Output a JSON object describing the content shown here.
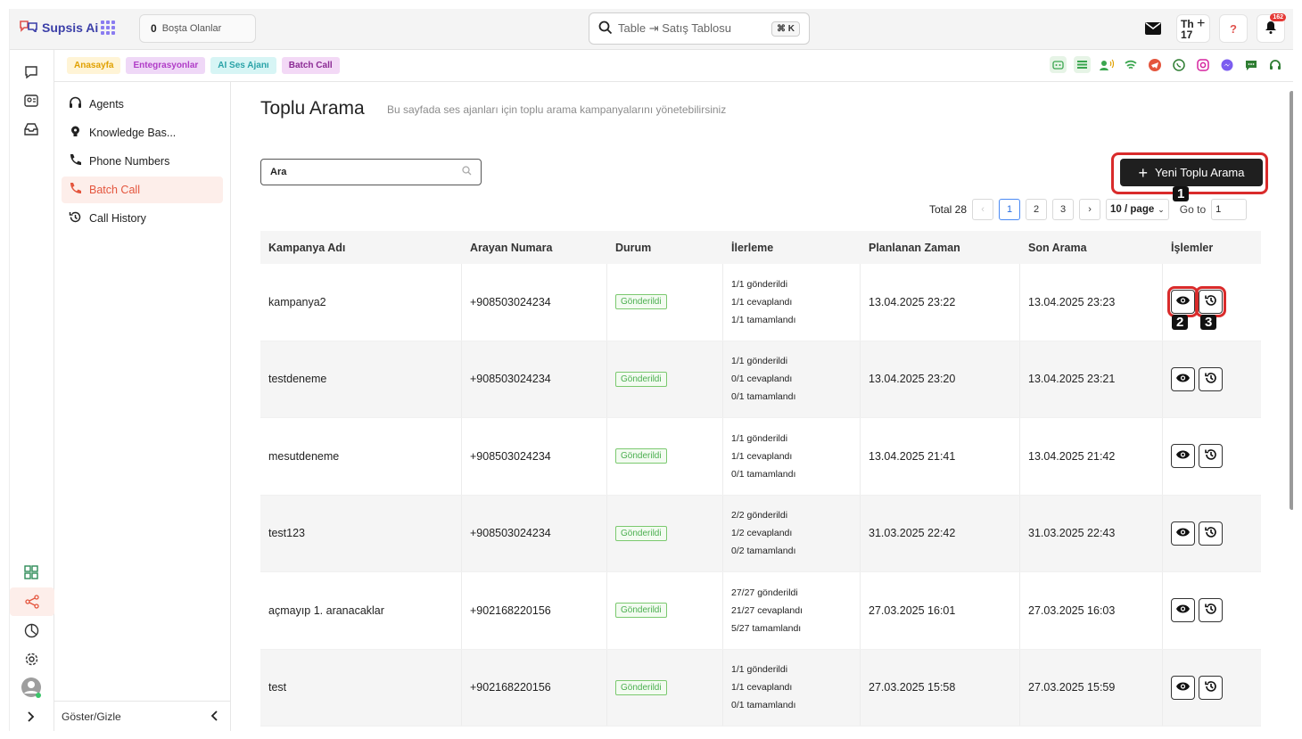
{
  "app": {
    "name": "Supsis Ai",
    "idle": {
      "count": "0",
      "label": "Boşta Olanlar"
    },
    "search": {
      "text": "Table ⇥ Satış Tablosu",
      "shortcut": "⌘ K"
    },
    "user_badge": {
      "line1": "Th",
      "line2": "17"
    },
    "help": "?",
    "notifications": "162"
  },
  "tags": [
    "Anasayfa",
    "Entegrasyonlar",
    "AI Ses Ajanı",
    "Batch Call"
  ],
  "sidenav": {
    "items": [
      {
        "label": "Agents",
        "icon": "headset-icon"
      },
      {
        "label": "Knowledge Bas...",
        "icon": "bulb-icon"
      },
      {
        "label": "Phone Numbers",
        "icon": "phone-icon"
      },
      {
        "label": "Batch Call",
        "icon": "phone-call-icon",
        "active": true
      },
      {
        "label": "Call History",
        "icon": "history-icon"
      }
    ],
    "toggle_label": "Göster/Gizle"
  },
  "page": {
    "title": "Toplu Arama",
    "subtitle": "Bu sayfada ses ajanları için toplu arama kampanyalarını yönetebilirsiniz",
    "search_placeholder": "Ara",
    "new_button": "Yeni Toplu Arama"
  },
  "pagination": {
    "total": "Total 28",
    "pages": [
      "1",
      "2",
      "3"
    ],
    "current": "1",
    "page_size": "10 / page",
    "goto_label": "Go to",
    "goto_value": "1"
  },
  "markers": [
    "1",
    "2",
    "3"
  ],
  "table": {
    "columns": [
      "Kampanya Adı",
      "Arayan Numara",
      "Durum",
      "İlerleme",
      "Planlanan Zaman",
      "Son Arama",
      "İşlemler"
    ],
    "rows": [
      {
        "name": "kampanya2",
        "number": "+908503024234",
        "status": "Gönderildi",
        "sent": "1/1 gönderildi",
        "answered": "1/1 cevaplandı",
        "completed": "1/1 tamamlandı",
        "planned": "13.04.2025 23:22",
        "last": "13.04.2025 23:23"
      },
      {
        "name": "testdeneme",
        "number": "+908503024234",
        "status": "Gönderildi",
        "sent": "1/1 gönderildi",
        "answered": "0/1 cevaplandı",
        "completed": "0/1 tamamlandı",
        "planned": "13.04.2025 23:20",
        "last": "13.04.2025 23:21"
      },
      {
        "name": "mesutdeneme",
        "number": "+908503024234",
        "status": "Gönderildi",
        "sent": "1/1 gönderildi",
        "answered": "1/1 cevaplandı",
        "completed": "0/1 tamamlandı",
        "planned": "13.04.2025 21:41",
        "last": "13.04.2025 21:42"
      },
      {
        "name": "test123",
        "number": "+908503024234",
        "status": "Gönderildi",
        "sent": "2/2 gönderildi",
        "answered": "1/2 cevaplandı",
        "completed": "0/2 tamamlandı",
        "planned": "31.03.2025 22:42",
        "last": "31.03.2025 22:43"
      },
      {
        "name": "açmayıp 1. aranacaklar",
        "number": "+902168220156",
        "status": "Gönderildi",
        "sent": "27/27 gönderildi",
        "answered": "21/27 cevaplandı",
        "completed": "5/27 tamamlandı",
        "planned": "27.03.2025 16:01",
        "last": "27.03.2025 16:03"
      },
      {
        "name": "test",
        "number": "+902168220156",
        "status": "Gönderildi",
        "sent": "1/1 gönderildi",
        "answered": "1/1 cevaplandı",
        "completed": "0/1 tamamlandı",
        "planned": "27.03.2025 15:58",
        "last": "27.03.2025 15:59"
      }
    ]
  },
  "colors": {
    "accent": "#e4553d",
    "status_green": "#4caf50",
    "highlight": "#d92b2b"
  }
}
